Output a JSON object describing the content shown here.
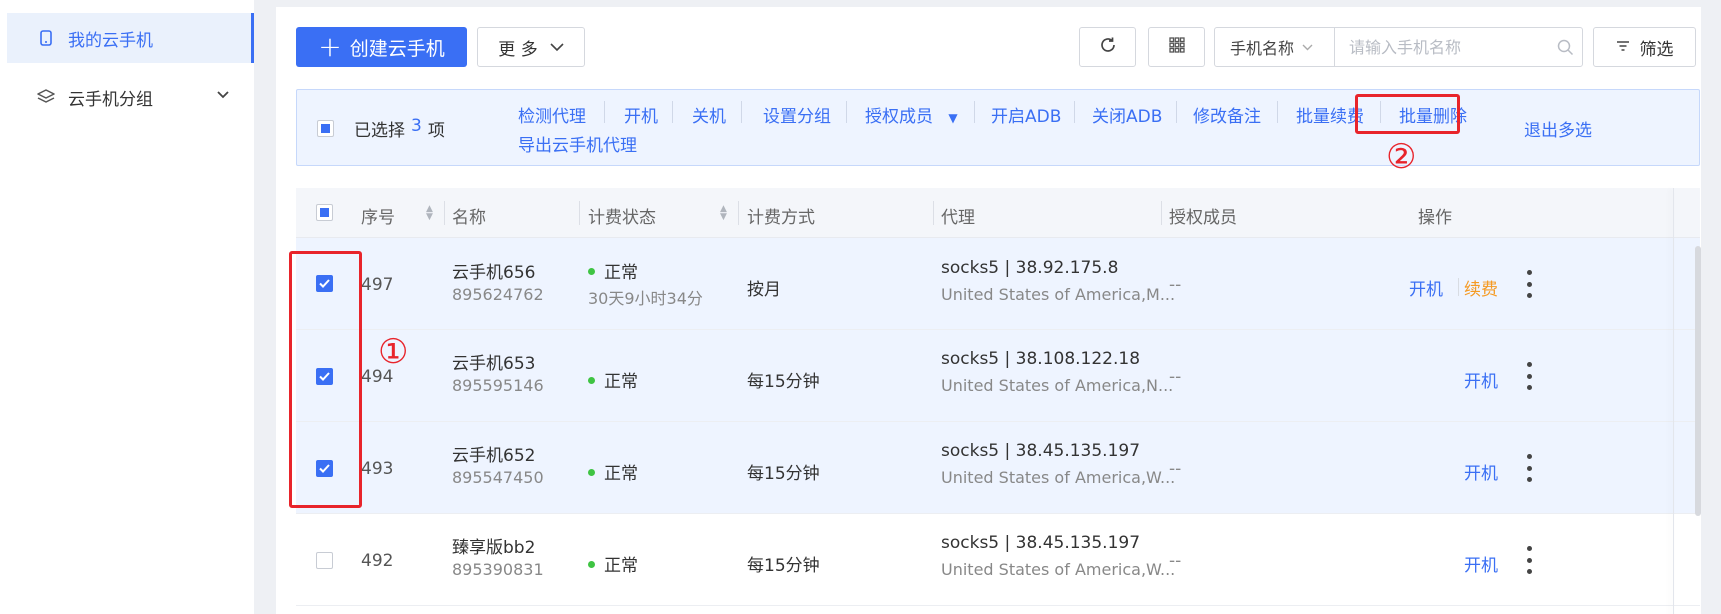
{
  "sidebar": {
    "items": [
      {
        "label": "我的云手机",
        "icon": "phone-icon",
        "active": true
      },
      {
        "label": "云手机分组",
        "icon": "layers-icon",
        "expandable": true
      }
    ]
  },
  "toolbar": {
    "create_label": "创建云手机",
    "more_label": "更 多",
    "search_field_label": "手机名称",
    "search_placeholder": "请输入手机名称",
    "filter_label": "筛选"
  },
  "batch": {
    "selected_prefix": "已选择",
    "selected_count": "3",
    "selected_suffix": "项",
    "actions": [
      "检测代理",
      "开机",
      "关机",
      "设置分组",
      "授权成员",
      "开启ADB",
      "关闭ADB",
      "修改备注",
      "批量续费",
      "批量删除"
    ],
    "export_label": "导出云手机代理",
    "exit_label": "退出多选"
  },
  "annotations": {
    "one": "①",
    "two": "②"
  },
  "table": {
    "headers": {
      "index": "序号",
      "name": "名称",
      "billing_status": "计费状态",
      "billing_method": "计费方式",
      "proxy": "代理",
      "members": "授权成员",
      "ops": "操作"
    },
    "rows": [
      {
        "index": "497",
        "name": "云手机656",
        "id": "895624762",
        "status": "正常",
        "remaining": "30天9小时34分",
        "method": "按月",
        "proxy": "socks5 | 38.92.175.8",
        "location": "United States of America,M...",
        "members": "--",
        "op_power": "开机",
        "op_renew": "续费",
        "checked": true
      },
      {
        "index": "494",
        "name": "云手机653",
        "id": "895595146",
        "status": "正常",
        "remaining": "",
        "method": "每15分钟",
        "proxy": "socks5 | 38.108.122.18",
        "location": "United States of America,N...",
        "members": "--",
        "op_power": "开机",
        "checked": true
      },
      {
        "index": "493",
        "name": "云手机652",
        "id": "895547450",
        "status": "正常",
        "remaining": "",
        "method": "每15分钟",
        "proxy": "socks5 | 38.45.135.197",
        "location": "United States of America,W...",
        "members": "--",
        "op_power": "开机",
        "checked": true
      },
      {
        "index": "492",
        "name": "臻享版bb2",
        "id": "895390831",
        "status": "正常",
        "remaining": "",
        "method": "每15分钟",
        "proxy": "socks5 | 38.45.135.197",
        "location": "United States of America,W...",
        "members": "--",
        "op_power": "开机",
        "checked": false
      }
    ]
  },
  "colors": {
    "accent": "#3a6ff4",
    "renew": "#f59a23",
    "status_ok": "#3fc443",
    "annotation_red": "#e8242b"
  }
}
